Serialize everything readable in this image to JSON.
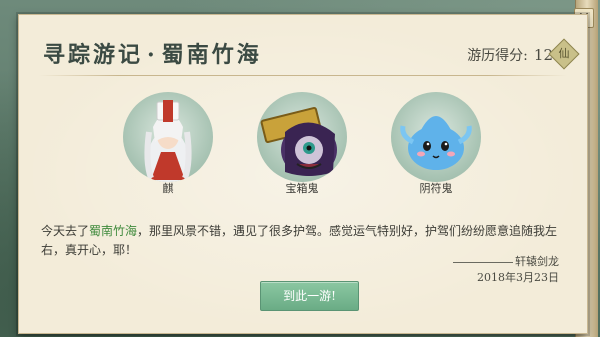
{
  "header": {
    "title_prefix": "寻踪游记",
    "title_separator": "·",
    "title_place": "蜀南竹海",
    "score_label": "游历得分:",
    "score_value": "12",
    "score_icon_glyph": "仙"
  },
  "characters": [
    {
      "name": "麒",
      "icon": "qilin-portrait"
    },
    {
      "name": "宝箱鬼",
      "icon": "treasure-ghost-portrait"
    },
    {
      "name": "阴符鬼",
      "icon": "yin-talisman-ghost-portrait"
    }
  ],
  "journal": {
    "text_before": "今天去了",
    "highlight_place": "蜀南竹海",
    "text_after": "，那里风景不错，遇见了很多护驾。感觉运气特别好，护驾们纷纷愿意追随我左右，真开心，耶！",
    "author": "轩辕剑龙",
    "date": "2018年3月23日"
  },
  "action": {
    "go_label": "到此一游!"
  },
  "close_glyph": "✕",
  "colors": {
    "highlight": "#3f8a3c",
    "button": "#6aac85",
    "paper": "#f3ecd9"
  }
}
